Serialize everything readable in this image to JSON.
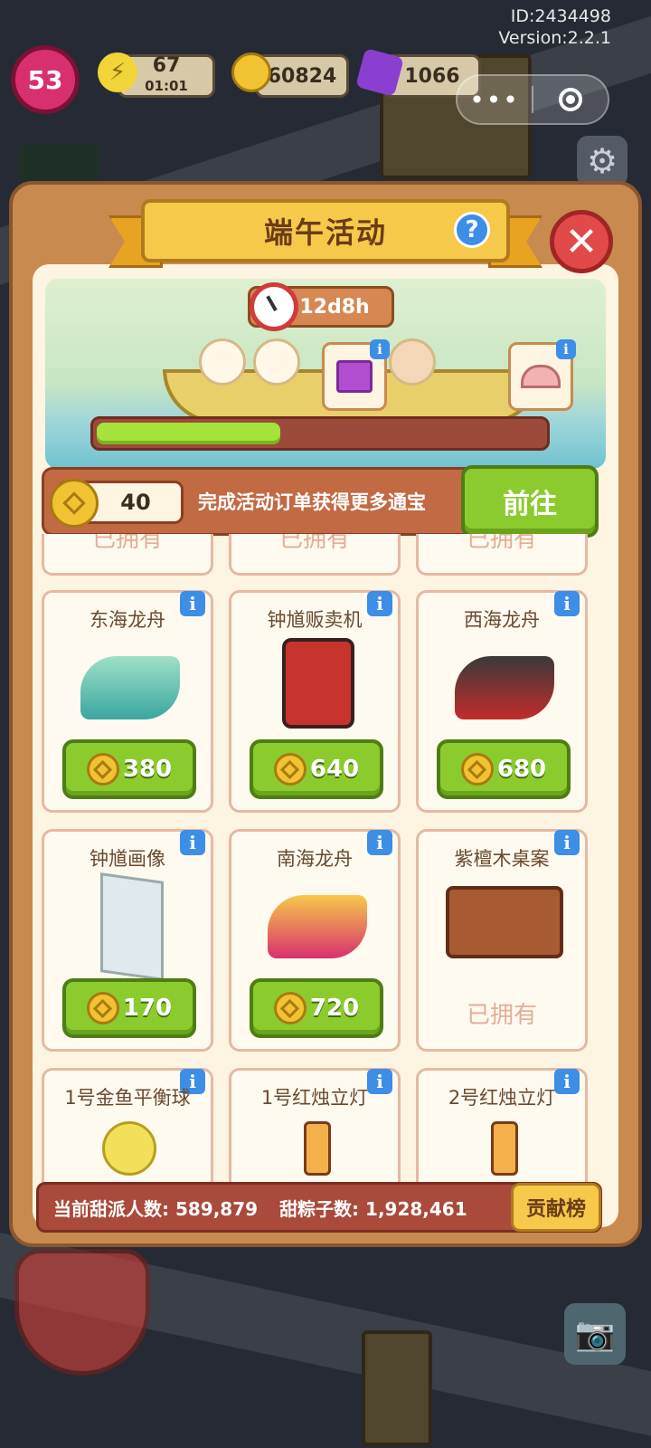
{
  "meta": {
    "id": "ID:2434498",
    "version": "Version:2.2.1"
  },
  "hud": {
    "level": "53",
    "energy": "67",
    "energy_timer": "01:01",
    "coins": "60824",
    "gems": "1066"
  },
  "dialog": {
    "title": "端午活动",
    "help": "?",
    "close": "✕",
    "timer": "12d8h",
    "progress": 0.41,
    "coin_count": "40",
    "coin_desc": "完成活动订单获得更多通宝",
    "go_label": "前往"
  },
  "items": [
    {
      "name": "东海龙舟",
      "price": "380",
      "owned": false
    },
    {
      "name": "钟馗贩卖机",
      "price": "640",
      "owned": false
    },
    {
      "name": "西海龙舟",
      "price": "680",
      "owned": false
    },
    {
      "name": "钟馗画像",
      "price": "170",
      "owned": false
    },
    {
      "name": "南海龙舟",
      "price": "720",
      "owned": false
    },
    {
      "name": "紫檀木桌案",
      "price": "",
      "owned": true
    },
    {
      "name": "1号金鱼平衡球",
      "price": "",
      "owned": false
    },
    {
      "name": "1号红烛立灯",
      "price": "",
      "owned": false
    },
    {
      "name": "2号红烛立灯",
      "price": "",
      "owned": false
    }
  ],
  "owned_label": "已拥有",
  "partial_row_label": "已拥有",
  "info_label": "i",
  "footer": {
    "players_label": "当前甜派人数: 589,879",
    "zongzi_label": "甜粽子数: 1,928,461",
    "rank_label": "贡献榜"
  },
  "colors": {
    "panel": "#c98a50",
    "button_green": "#8ccb2e",
    "progress_green": "#a5e23a",
    "title_gold": "#f7c94a"
  }
}
